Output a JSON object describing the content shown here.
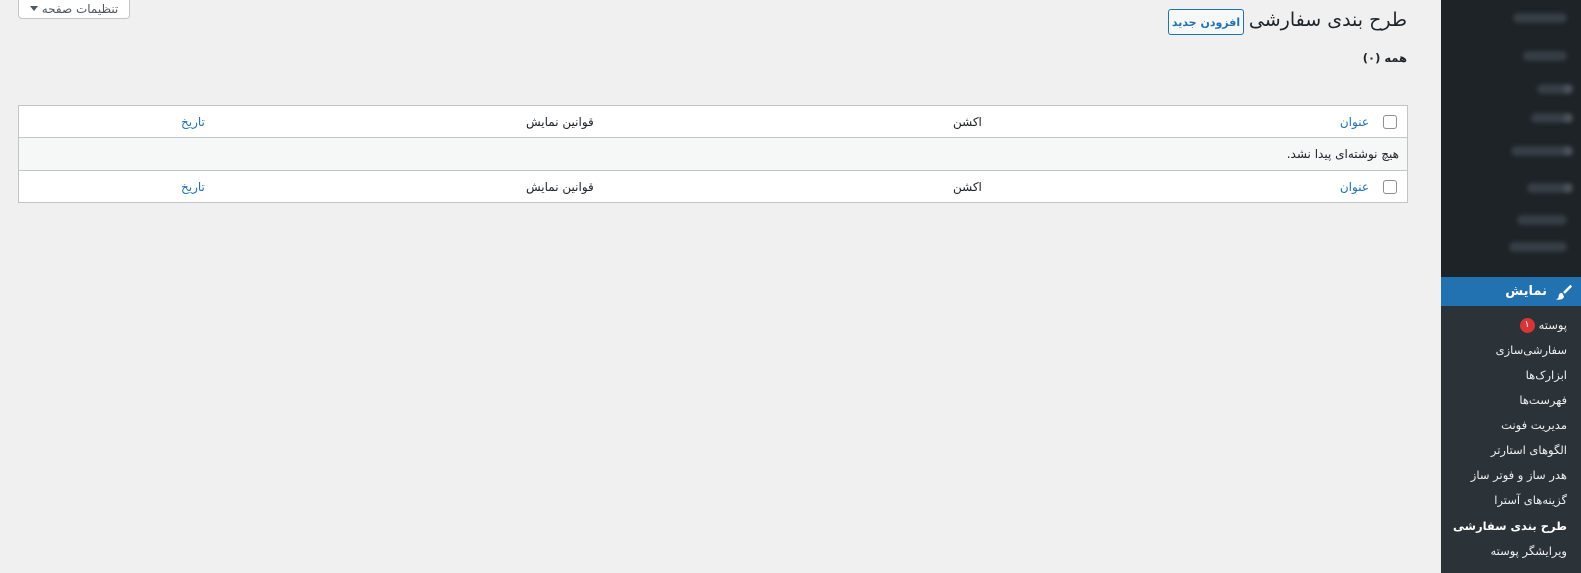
{
  "screen_options": {
    "label": "تنظیمات صفحه"
  },
  "header": {
    "title": "طرح بندی سفارشی",
    "add_new": "افزودن جدید"
  },
  "filter": {
    "all": "همه (۰)"
  },
  "table": {
    "columns": {
      "title": "عنوان",
      "action": "اکشن",
      "display_rules": "قوانین نمایش",
      "date": "تاریخ"
    },
    "empty_message": "هیچ نوشته‌ای پیدا نشد."
  },
  "sidebar": {
    "active_menu": "نمایش",
    "items": [
      {
        "label": "پوسته",
        "badge": "۱"
      },
      {
        "label": "سفارشی‌سازی"
      },
      {
        "label": "ابزارک‌ها"
      },
      {
        "label": "فهرست‌ها"
      },
      {
        "label": "مدیریت فونت"
      },
      {
        "label": "الگوهای استارتر"
      },
      {
        "label": "هدر ساز و فوتر ساز"
      },
      {
        "label": "گزینه‌های آسترا"
      },
      {
        "label": "طرح بندی سفارشی"
      },
      {
        "label": "ویرایشگر پوسته"
      }
    ]
  },
  "colors": {
    "accent": "#2271b1",
    "sidebar_bg": "#1d2327",
    "submenu_bg": "#2c3338",
    "badge": "#d63638"
  }
}
